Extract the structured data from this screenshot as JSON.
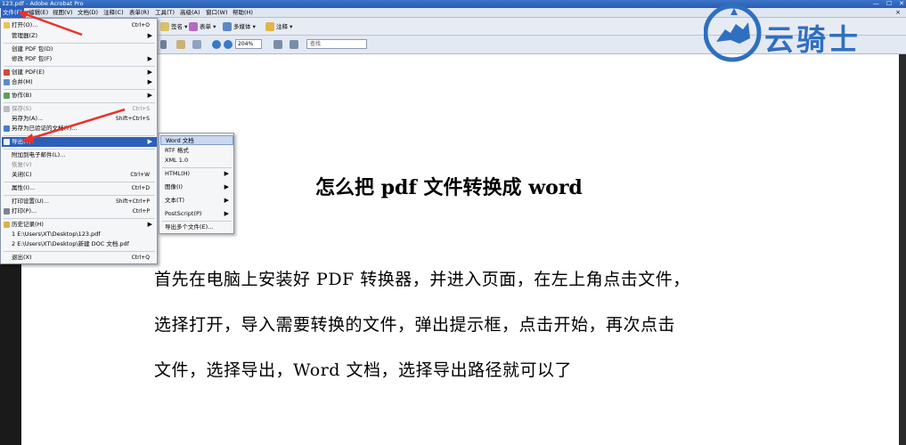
{
  "window": {
    "title": "123.pdf - Adobe Acrobat Pro",
    "controls": [
      "—",
      "☐",
      "✕"
    ]
  },
  "menubar": {
    "items": [
      "文件(F)",
      "编辑(E)",
      "视图(V)",
      "文档(D)",
      "注释(C)",
      "表单(R)",
      "工具(T)",
      "高级(A)",
      "窗口(W)",
      "帮助(H)"
    ],
    "close": "×"
  },
  "toolbar": {
    "sign": "签名 ▾",
    "forms": "表单 ▾",
    "multimedia": "多媒体 ▾",
    "comment": "注释 ▾",
    "zoom": "204%",
    "find_placeholder": "查找"
  },
  "file_menu": {
    "items": [
      {
        "label": "打开(O)...",
        "shortcut": "Ctrl+O"
      },
      {
        "label": "管理器(Z)",
        "arrow": "▶"
      },
      {
        "label": "创建 PDF 包(D)"
      },
      {
        "label": "修改 PDF 包(F)",
        "arrow": "▶"
      },
      {
        "label": "创建 PDF(E)",
        "arrow": "▶"
      },
      {
        "label": "合并(M)",
        "arrow": "▶"
      },
      {
        "label": "协作(B)",
        "arrow": "▶"
      },
      {
        "label": "保存(S)",
        "shortcut": "Ctrl+S"
      },
      {
        "label": "另存为(A)...",
        "shortcut": "Shift+Ctrl+S"
      },
      {
        "label": "另存为已验证的文档(T)..."
      },
      {
        "label": "导出(T)",
        "arrow": "▶"
      },
      {
        "label": "附加到电子邮件(L)..."
      },
      {
        "label": "恢复(V)"
      },
      {
        "label": "关闭(C)",
        "shortcut": "Ctrl+W"
      },
      {
        "label": "属性(I)...",
        "shortcut": "Ctrl+D"
      },
      {
        "label": "打印设置(U)...",
        "shortcut": "Shift+Ctrl+P"
      },
      {
        "label": "打印(P)...",
        "shortcut": "Ctrl+P"
      },
      {
        "label": "历史记录(H)",
        "arrow": "▶"
      },
      {
        "label": "1 E:\\Users\\XT\\Desktop\\123.pdf"
      },
      {
        "label": "2 E:\\Users\\XT\\Desktop\\新建 DOC 文档.pdf"
      },
      {
        "label": "退出(X)",
        "shortcut": "Ctrl+Q"
      }
    ]
  },
  "export_submenu": {
    "items": [
      {
        "label": "Word 文档"
      },
      {
        "label": "RTF 格式"
      },
      {
        "label": "XML 1.0"
      },
      {
        "label": "HTML(H)",
        "arrow": "▶"
      },
      {
        "label": "图像(I)",
        "arrow": "▶"
      },
      {
        "label": "文本(T)",
        "arrow": "▶"
      },
      {
        "label": "PostScript(P)",
        "arrow": "▶"
      },
      {
        "label": "导出多个文件(E)..."
      }
    ]
  },
  "document": {
    "title": "怎么把 pdf 文件转换成 word",
    "lines": [
      "首先在电脑上安装好 PDF 转换器，并进入页面，在左上角点击文件，",
      "选择打开，导入需要转换的文件，弹出提示框，点击开始，再次点击",
      "文件，选择导出，Word 文档，选择导出路径就可以了"
    ]
  },
  "watermark": {
    "text": "云骑士"
  },
  "colors": {
    "accent": "#2b62c4",
    "annotation": "#e8322b",
    "watermark": "#2f6fc0"
  }
}
